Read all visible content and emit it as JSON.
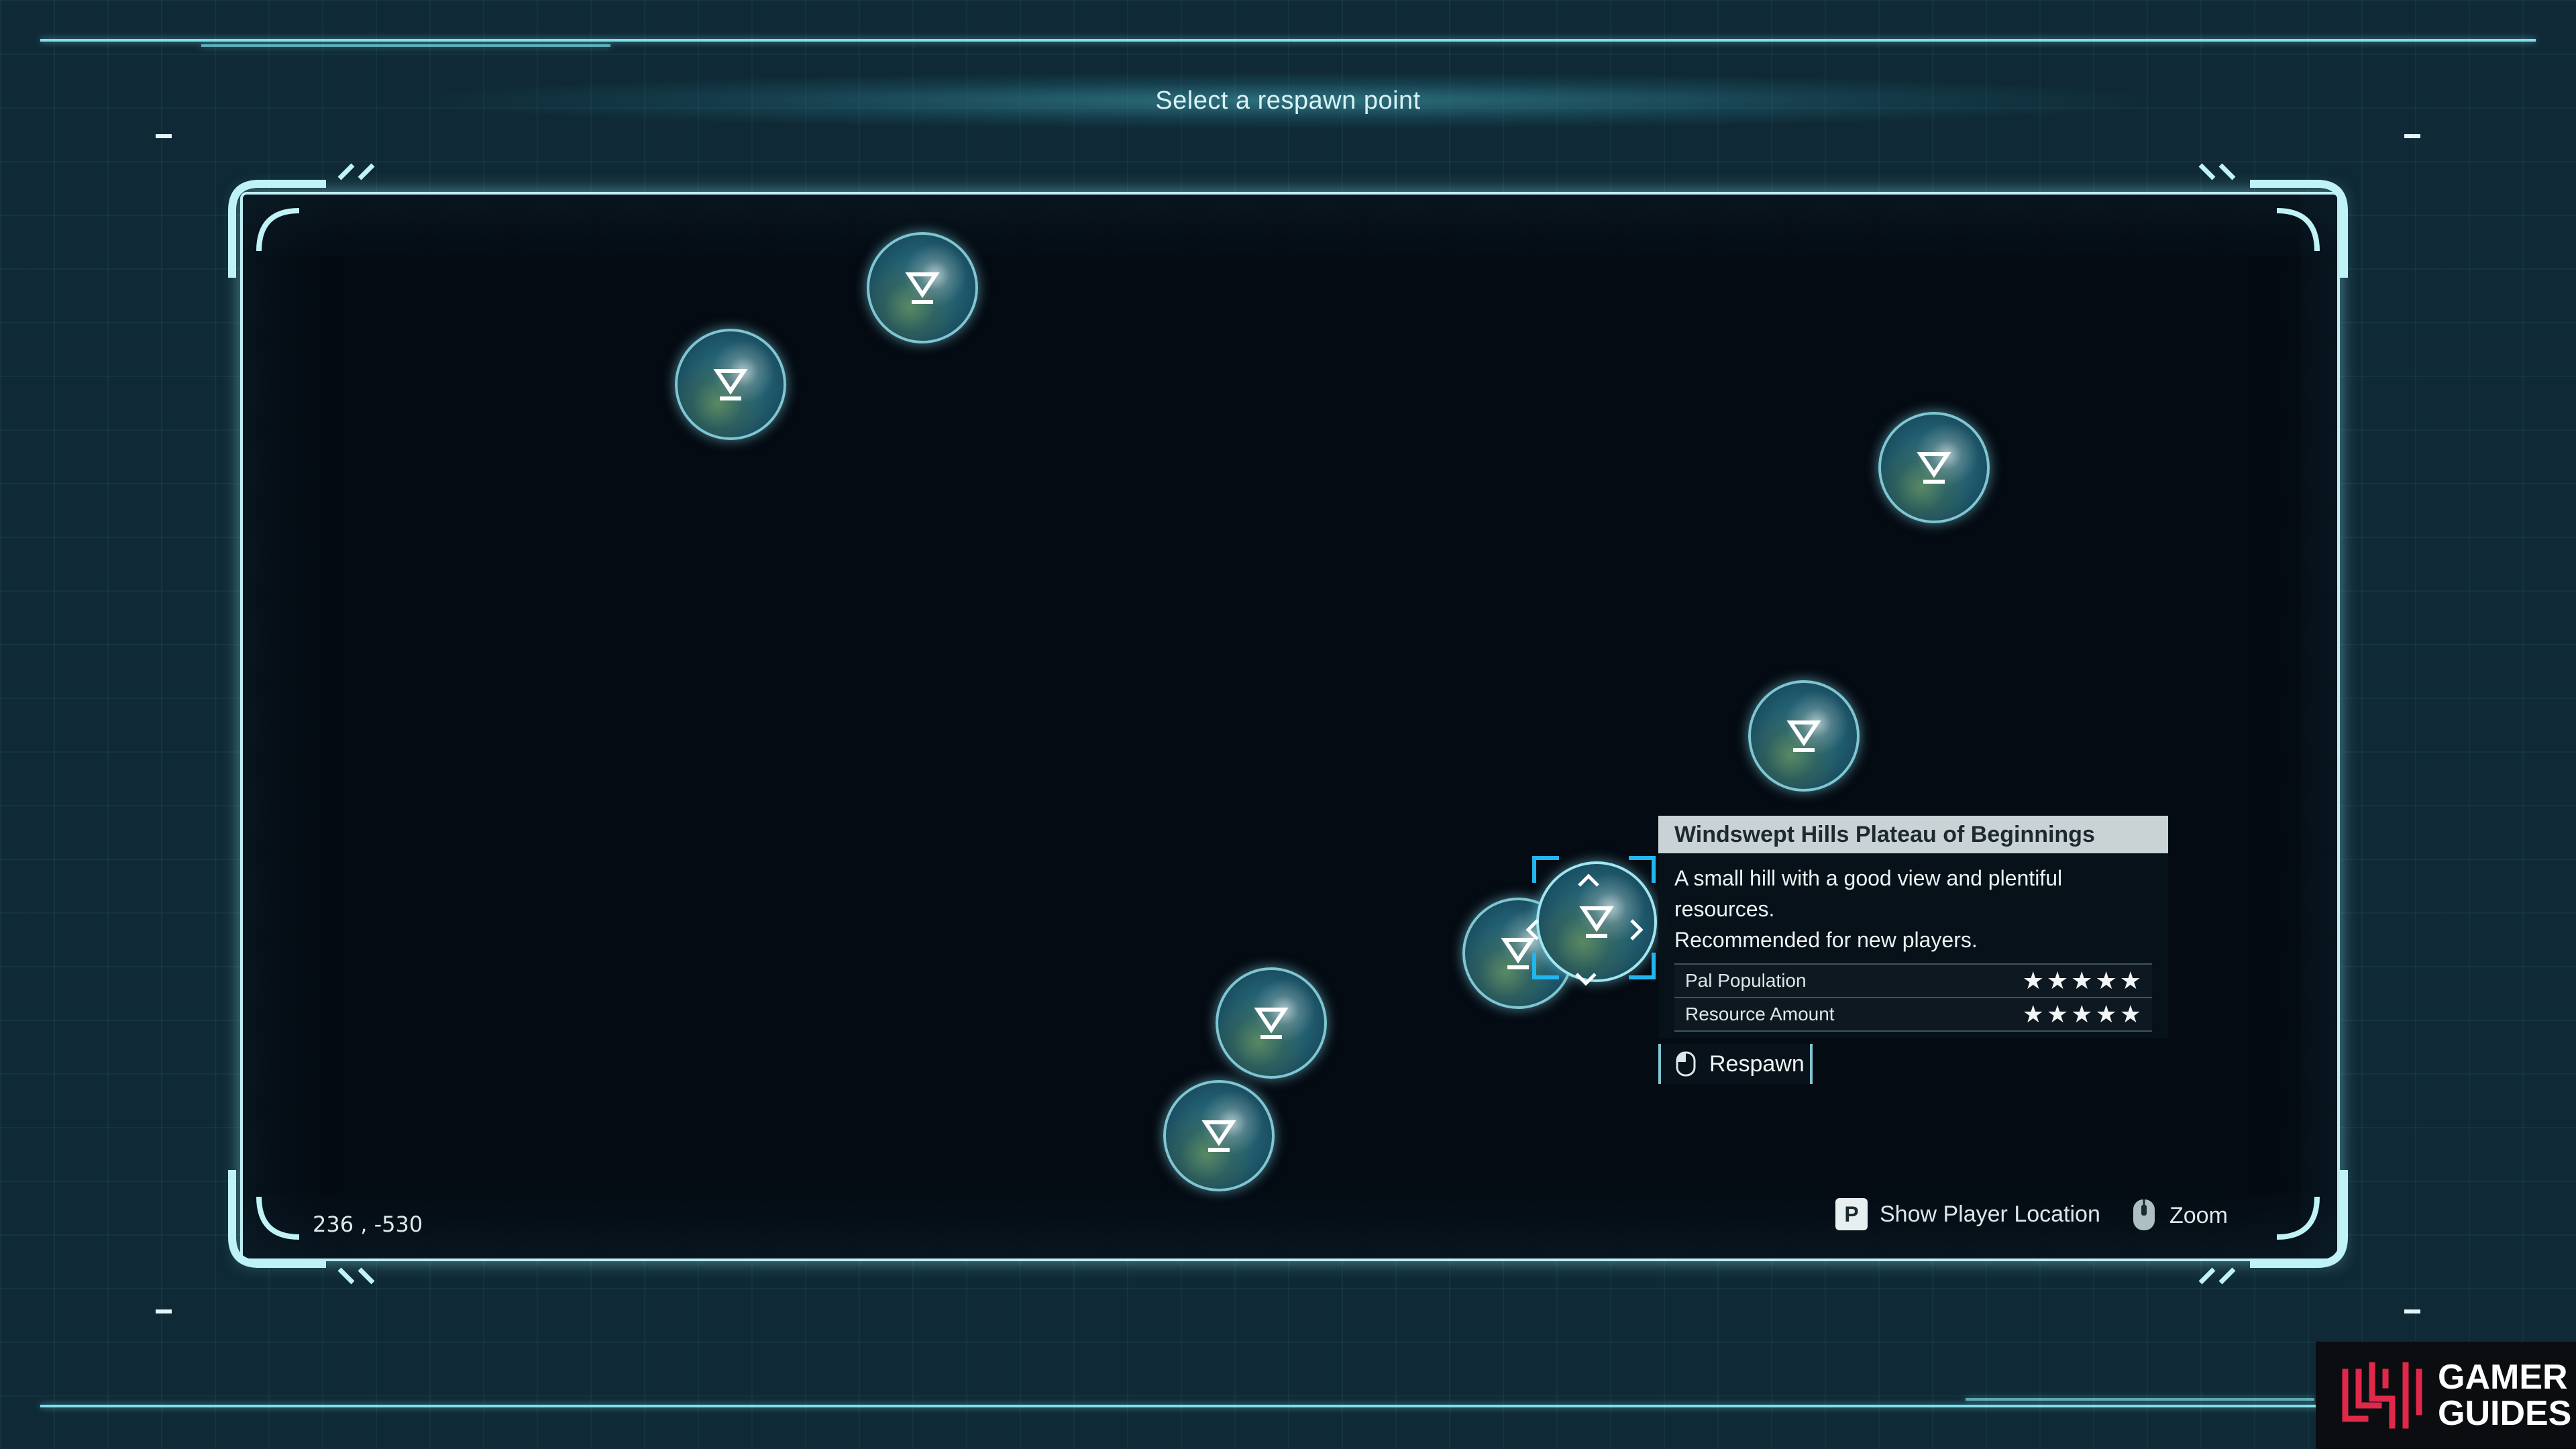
{
  "header": {
    "title": "Select a respawn point"
  },
  "map": {
    "respawn_points": [
      {
        "name": "fast-travel-point"
      },
      {
        "name": "fast-travel-point"
      },
      {
        "name": "fast-travel-point"
      },
      {
        "name": "fast-travel-point"
      },
      {
        "name": "fast-travel-point"
      },
      {
        "name": "fast-travel-point"
      },
      {
        "name": "fast-travel-point"
      },
      {
        "name": "fast-travel-point",
        "selected": true
      }
    ]
  },
  "info_panel": {
    "title": "Windswept Hills Plateau of Beginnings",
    "description_line1": "A small hill with a good view and plentiful",
    "description_line2": "resources.",
    "description_line3": "Recommended for new players.",
    "stats": [
      {
        "label": "Pal Population",
        "stars": "★★★★★",
        "rating": 5,
        "max": 5
      },
      {
        "label": "Resource Amount",
        "stars": "★★★★★",
        "rating": 5,
        "max": 5
      }
    ]
  },
  "respawn_button": {
    "label": "Respawn",
    "icon": "mouse-left-click-icon"
  },
  "coordinates": "236 , -530",
  "hints": {
    "show_player_key": "P",
    "show_player_label": "Show Player Location",
    "zoom_icon": "mouse-scroll-icon",
    "zoom_label": "Zoom"
  },
  "watermark": {
    "line1": "GAMER",
    "line2": "GUIDES"
  },
  "colors": {
    "accent": "#7fe0ec",
    "selection": "#22b6f0",
    "panel_header": "#c9d3d6",
    "map_background": "#050b13"
  }
}
